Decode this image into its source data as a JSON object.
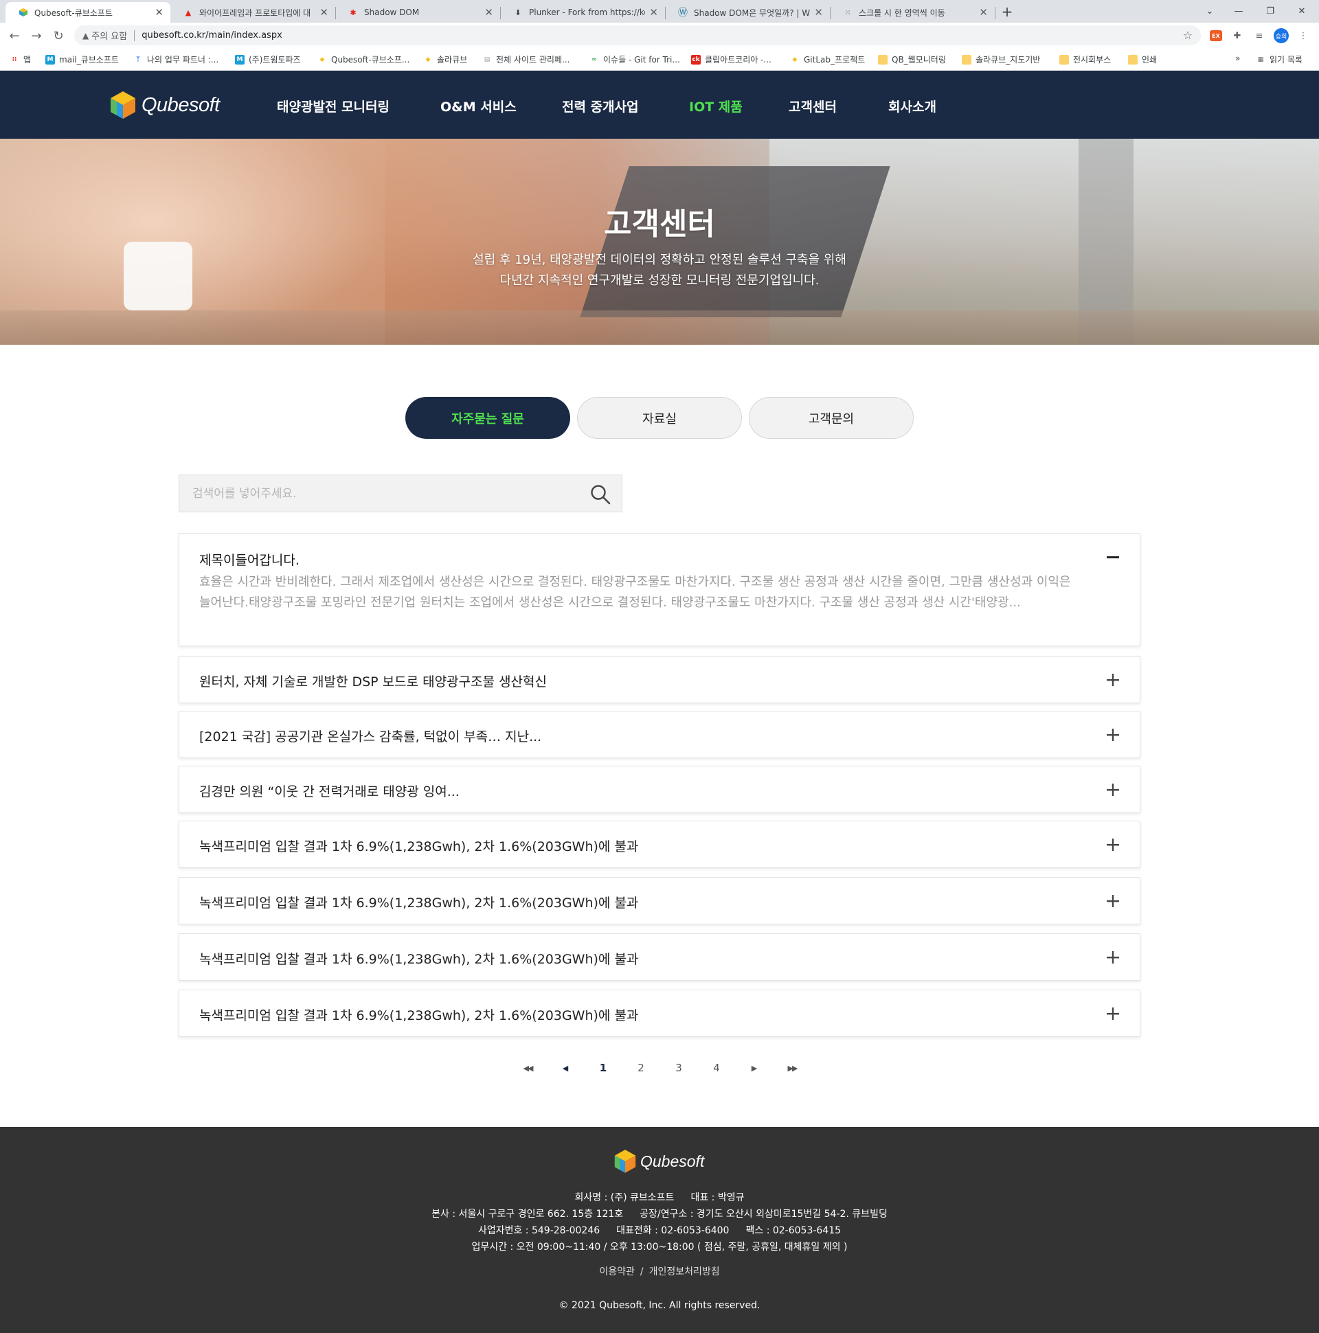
{
  "browser": {
    "tabs": [
      {
        "title": "Qubesoft-큐브소프트",
        "favicon": "cube-icon",
        "active": true
      },
      {
        "title": "와이어프레임과 프로토타입에 대",
        "favicon": "adobe-icon",
        "active": false
      },
      {
        "title": "Shadow DOM",
        "favicon": "figure-icon",
        "active": false
      },
      {
        "title": "Plunker - Fork from https://ko.ja",
        "favicon": "plunker-icon",
        "active": false
      },
      {
        "title": "Shadow DOM은 무엇일까? | WI",
        "favicon": "wordpress-icon",
        "active": false
      },
      {
        "title": "스크롤 시 한 영역씩 이동",
        "favicon": "dots-icon",
        "active": false
      }
    ],
    "address": {
      "security_label": "주의 요함",
      "url": "qubesoft.co.kr/main/index.aspx"
    },
    "profile_initial": "승희",
    "bookmarks": [
      {
        "label": "앱",
        "icon": "apps-icon"
      },
      {
        "label": "mail_큐브소프트",
        "icon": "m-icon"
      },
      {
        "label": "나의 업무 파트너 :...",
        "icon": "partner-icon"
      },
      {
        "label": "(주)트윔토파즈",
        "icon": "m-icon"
      },
      {
        "label": "Qubesoft-큐브소프...",
        "icon": "cube-icon"
      },
      {
        "label": "솔라큐브",
        "icon": "cube-icon"
      },
      {
        "label": "전체 사이트 관리페...",
        "icon": "doc-icon"
      },
      {
        "label": "이슈들 - Git for Tri...",
        "icon": "git-icon"
      },
      {
        "label": "클립아트코리아 -...",
        "icon": "ck-icon"
      },
      {
        "label": "GitLab_프로젝트",
        "icon": "cube-icon"
      },
      {
        "label": "QB_웹모니터링",
        "icon": "folder-icon"
      },
      {
        "label": "솔라큐브_지도기반",
        "icon": "folder-icon"
      },
      {
        "label": "전시회부스",
        "icon": "folder-icon"
      },
      {
        "label": "인쇄",
        "icon": "folder-icon"
      }
    ],
    "reading_list": "읽기 목록"
  },
  "site": {
    "logo_text": "Qubesoft",
    "nav": [
      {
        "label": "태양광발전 모니터링",
        "active": false
      },
      {
        "label": "O&M 서비스",
        "active": false
      },
      {
        "label": "전력 중개사업",
        "active": false
      },
      {
        "label": "IOT 제품",
        "active": true
      },
      {
        "label": "고객센터",
        "active": false
      },
      {
        "label": "회사소개",
        "active": false
      }
    ],
    "accent_color": "#4fe04f",
    "navy_color": "#1a2a44"
  },
  "hero": {
    "title": "고객센터",
    "subtitle_line1": "설립 후 19년, 태양광발전 데이터의 정확하고 안정된 솔루션 구축을 위해",
    "subtitle_line2": "다년간 지속적인 연구개발로 성장한 모니터링 전문기업입니다."
  },
  "tabs": [
    {
      "label": "자주묻는 질문",
      "active": true
    },
    {
      "label": "자료실",
      "active": false
    },
    {
      "label": "고객문의",
      "active": false
    }
  ],
  "search": {
    "placeholder": "검색어를 넣어주세요.",
    "value": ""
  },
  "faq": [
    {
      "title": "제목이들어갑니다.",
      "expanded": true,
      "body": "효율은 시간과 반비례한다. 그래서 제조업에서 생산성은 시간으로 결정된다. 태양광구조물도 마찬가지다. 구조물 생산 공정과 생산 시간을 줄이면, 그만큼 생산성과 이익은 늘어난다.태양광구조물 포밍라인 전문기업 원터치는 조업에서 생산성은 시간으로 결정된다. 태양광구조물도 마찬가지다. 구조물 생산 공정과 생산 시간'태양광..."
    },
    {
      "title": "원터치, 자체 기술로 개발한 DSP 보드로 태양광구조물 생산혁신",
      "expanded": false
    },
    {
      "title": "[2021 국감] 공공기관 온실가스 감축률, 턱없이 부족… 지난...",
      "expanded": false
    },
    {
      "title": "김경만 의원 “이웃 간 전력거래로 태양광 잉여...",
      "expanded": false
    },
    {
      "title": "녹색프리미엄 입찰 결과 1차 6.9%(1,238Gwh), 2차 1.6%(203GWh)에 불과",
      "expanded": false
    },
    {
      "title": "녹색프리미엄 입찰 결과 1차 6.9%(1,238Gwh), 2차 1.6%(203GWh)에 불과",
      "expanded": false
    },
    {
      "title": "녹색프리미엄 입찰 결과 1차 6.9%(1,238Gwh), 2차 1.6%(203GWh)에 불과",
      "expanded": false
    },
    {
      "title": "녹색프리미엄 입찰 결과 1차 6.9%(1,238Gwh), 2차 1.6%(203GWh)에 불과",
      "expanded": false
    }
  ],
  "pagination": {
    "first": "◀◀",
    "prev": "◀",
    "pages": [
      "1",
      "2",
      "3",
      "4"
    ],
    "current": "1",
    "next": "▶",
    "last": "▶▶"
  },
  "footer": {
    "logo_text": "Qubesoft",
    "company": "회사명 : (주) 큐브소프트",
    "ceo": "대표 : 박영규",
    "hq": "본사 : 서울시 구로구 경인로 662. 15층 121호",
    "factory": "공장/연구소 : 경기도 오산시 외삼미로15번길 54-2. 큐브빌딩",
    "bizno": "사업자번호 : 549-28-00246",
    "tel": "대표전화 : 02-6053-6400",
    "fax": "팩스 : 02-6053-6415",
    "hours": "업무시간 : 오전 09:00~11:40 / 오후 13:00~18:00 ( 점심, 주말, 공휴일, 대체휴일 제외 )",
    "terms": "이용약관",
    "privacy": "개인정보처리방침",
    "copyright": "© 2021 Qubesoft, Inc. All rights reserved."
  }
}
